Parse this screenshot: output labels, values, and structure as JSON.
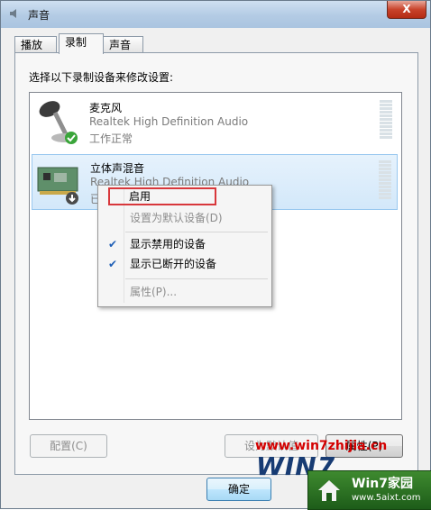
{
  "window": {
    "title": "声音",
    "close_label": "X"
  },
  "tabs": [
    {
      "label": "播放"
    },
    {
      "label": "录制",
      "active": true
    },
    {
      "label": "声音"
    }
  ],
  "instruction": "选择以下录制设备来修改设置:",
  "devices": [
    {
      "name": "麦克风",
      "driver": "Realtek High Definition Audio",
      "status": "工作正常",
      "icon": "microphone-icon",
      "badge": "green-check-icon"
    },
    {
      "name": "立体声混音",
      "driver": "Realtek High Definition Audio",
      "status": "已",
      "icon": "sound-card-icon",
      "badge": "down-arrow-icon",
      "selected": true
    }
  ],
  "context_menu": {
    "items": [
      {
        "label": "启用",
        "enabled": true,
        "highlighted": true
      },
      {
        "label": "设置为默认设备(D)",
        "enabled": false
      },
      {
        "label": "显示禁用的设备",
        "enabled": true,
        "checked": true
      },
      {
        "label": "显示已断开的设备",
        "enabled": true,
        "checked": true
      },
      {
        "label": "属性(P)...",
        "enabled": false
      }
    ]
  },
  "buttons": {
    "configure": "配置(C)",
    "set_default": "设为默认值",
    "properties": "属性(P)",
    "ok": "确定"
  },
  "watermark": {
    "url": "www.win7zhijia.cn",
    "logo_text": "WIN7",
    "badge_title": "Win7家园",
    "badge_url": "www.5aixt.com"
  },
  "colors": {
    "accent": "#3c7fb1",
    "highlight_border": "#d8373b",
    "watermark_red": "#d40000"
  }
}
